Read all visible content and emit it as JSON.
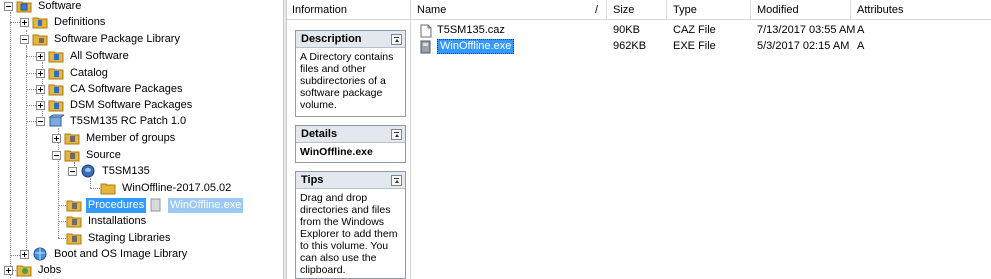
{
  "tree": {
    "items": [
      {
        "label": "Software",
        "icon": "software-folder-icon"
      },
      {
        "label": "Definitions",
        "icon": "folder-icon"
      },
      {
        "label": "Software Package Library",
        "icon": "folder-icon"
      },
      {
        "label": "All Software",
        "icon": "folder-icon"
      },
      {
        "label": "Catalog",
        "icon": "folder-icon"
      },
      {
        "label": "CA Software Packages",
        "icon": "folder-icon"
      },
      {
        "label": "DSM Software Packages",
        "icon": "folder-icon"
      },
      {
        "label": "T5SM135 RC Patch 1.0",
        "icon": "package-icon"
      },
      {
        "label": "Member of groups",
        "icon": "folder-icon"
      },
      {
        "label": "Source",
        "icon": "folder-icon"
      },
      {
        "label": "T5SM135",
        "icon": "volume-icon"
      },
      {
        "label": "WinOffline-2017.05.02",
        "icon": "folder-icon"
      },
      {
        "label": "Procedures",
        "icon": "folder-icon"
      },
      {
        "label": "Installations",
        "icon": "folder-icon"
      },
      {
        "label": "Staging Libraries",
        "icon": "folder-icon"
      },
      {
        "label": "Boot and OS Image Library",
        "icon": "globe-icon"
      },
      {
        "label": "Jobs",
        "icon": "jobs-icon"
      }
    ],
    "drag_ghost": "WinOffline.exe"
  },
  "info": {
    "header": "Information",
    "description": {
      "title": "Description",
      "body": "A Directory contains files and other subdirectories of a software package volume."
    },
    "details": {
      "title": "Details",
      "body": "WinOffline.exe"
    },
    "tips": {
      "title": "Tips",
      "body": "Drag and drop directories and files from the Windows Explorer to add them to this volume. You can also use the clipboard."
    }
  },
  "list": {
    "columns": {
      "name": "Name",
      "sort_indicator": "/",
      "size": "Size",
      "type": "Type",
      "modified": "Modified",
      "attributes": "Attributes"
    },
    "rows": [
      {
        "name": "T5SM135.caz",
        "size": "90KB",
        "type": "CAZ File",
        "modified": "7/13/2017 03:55 AM",
        "attributes": "A",
        "icon": "document-icon",
        "selected": false
      },
      {
        "name": "WinOffline.exe",
        "size": "962KB",
        "type": "EXE File",
        "modified": "5/3/2017 02:15 AM",
        "attributes": "A",
        "icon": "executable-icon",
        "selected": true
      }
    ]
  },
  "colors": {
    "selection": "#3399ff",
    "folder": "#e8b53c",
    "accent": "#1f5fbf"
  }
}
